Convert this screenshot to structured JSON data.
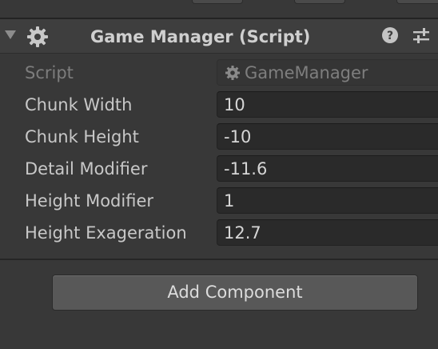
{
  "component": {
    "title": "Game Manager (Script)",
    "icons": {
      "foldout": "foldout-arrow-icon",
      "script": "gear-icon",
      "help": "help-icon",
      "settings": "settings-sliders-icon"
    }
  },
  "properties": {
    "script": {
      "label": "Script",
      "value": "GameManager"
    },
    "chunk_width": {
      "label": "Chunk Width",
      "value": "10"
    },
    "chunk_height": {
      "label": "Chunk Height",
      "value": "-10"
    },
    "detail_modifier": {
      "label": "Detail Modifier",
      "value": "-11.6"
    },
    "height_modifier": {
      "label": "Height Modifier",
      "value": "1"
    },
    "height_exageration": {
      "label": "Height Exageration",
      "value": "12.7"
    }
  },
  "add_component": {
    "label": "Add Component"
  },
  "colors": {
    "panel_bg": "#383838",
    "header_bg": "#3e3e3e",
    "field_bg": "#2a2a2a",
    "button_bg": "#585858",
    "text": "#d2d2d2",
    "disabled_text": "#7d7d7d"
  }
}
